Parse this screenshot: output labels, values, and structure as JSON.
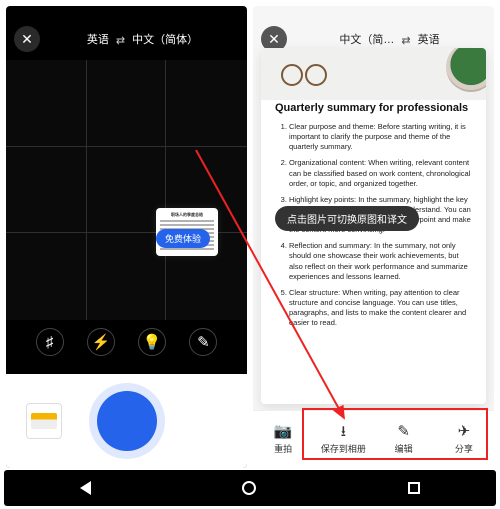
{
  "left": {
    "close_aria": "close",
    "lang_from": "英语",
    "lang_to": "中文（简体）",
    "swap_glyph": "⇄",
    "trial_label": "免费体验",
    "tile_title": "职场人的季度总结",
    "tools": {
      "grid_glyph": "♯",
      "flash_glyph": "⚡",
      "lamp_glyph": "💡",
      "mode_glyph": "✎"
    },
    "shutter_aria": "shutter"
  },
  "right": {
    "close_aria": "close",
    "lang_from": "中文（简…",
    "lang_to": "英语",
    "swap_glyph": "⇄",
    "doc_title": "Quarterly summary for professionals",
    "items": [
      "Clear purpose and theme: Before starting writing, it is important to clarify the purpose and theme of the quarterly summary.",
      "Organizational content: When writing, relevant content can be classified based on work content, chronological order, or topic, and organized together.",
      "Highlight key points: In the summary, highlight the key points so that readers can quickly understand. You can use data and facts to support your viewpoint and make the content more convincing.",
      "Reflection and summary: In the summary, not only should one showcase their work achievements, but also reflect on their work performance and summarize experiences and lessons learned.",
      "Clear structure: When writing, pay attention to clear structure and concise language. You can use titles, paragraphs, and lists to make the content clearer and easier to read."
    ],
    "toast": "点击图片可切换原图和译文",
    "actions": {
      "retake": "重拍",
      "retake_glyph": "⧇",
      "save": "保存到相册",
      "save_glyph": "⭳",
      "edit": "编辑",
      "edit_glyph": "✎",
      "share": "分享",
      "share_glyph": "✈"
    }
  },
  "nav": {
    "back_aria": "back",
    "home_aria": "home",
    "recent_aria": "recent"
  }
}
